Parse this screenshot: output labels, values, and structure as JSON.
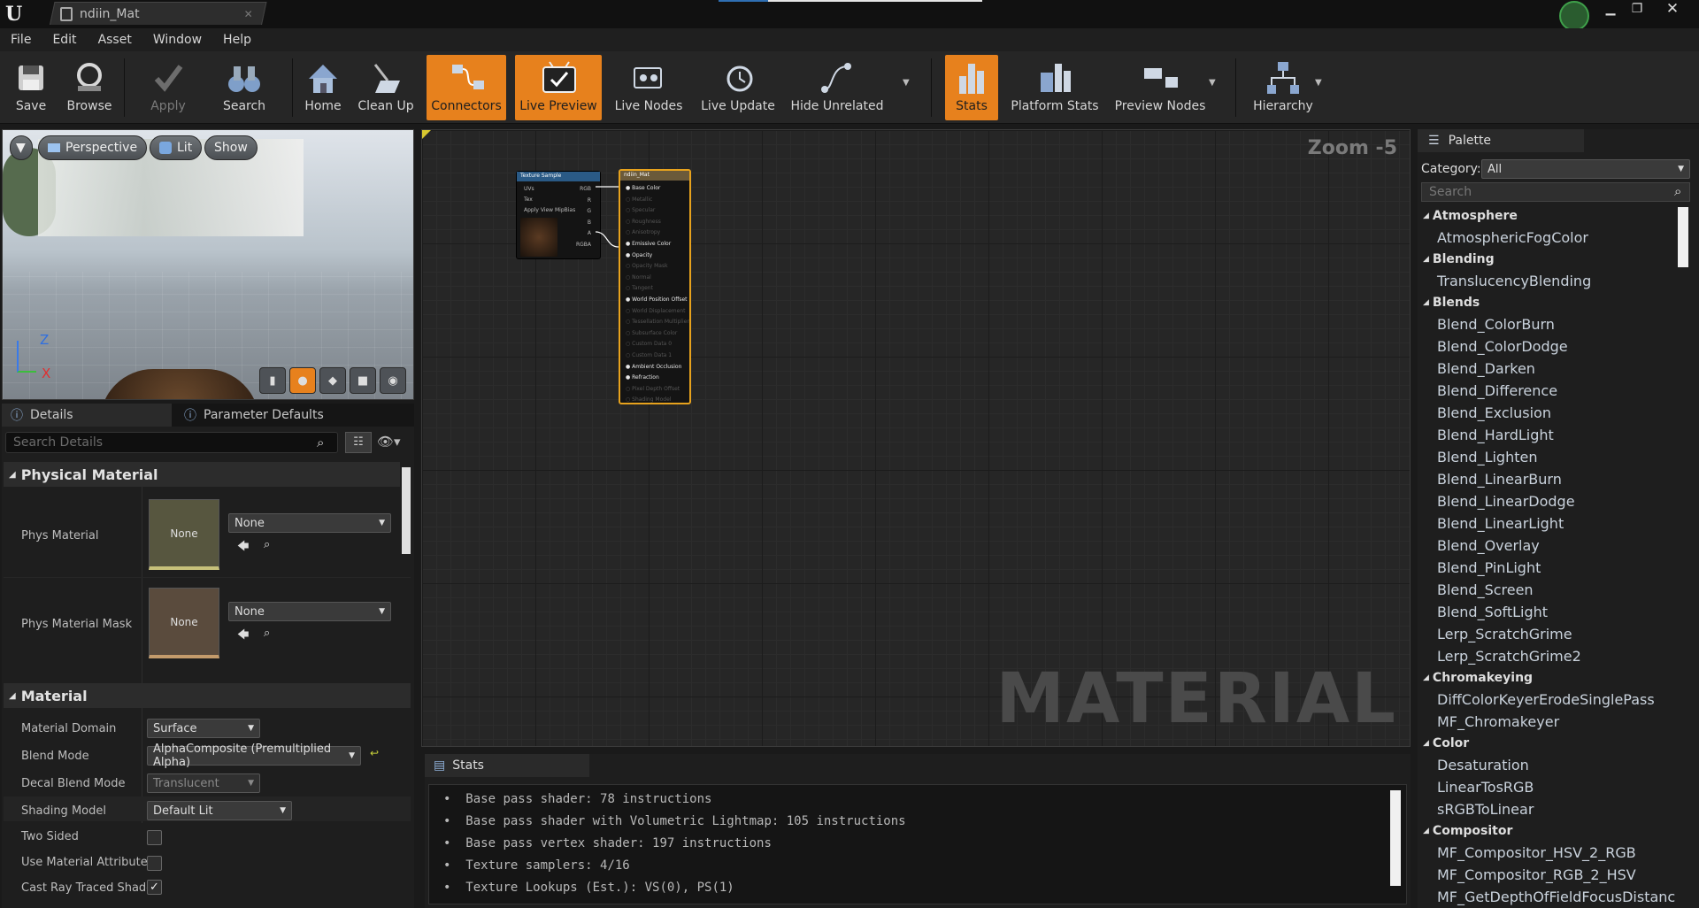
{
  "window": {
    "tab_title": "ndiin_Mat"
  },
  "menu": [
    "File",
    "Edit",
    "Asset",
    "Window",
    "Help"
  ],
  "toolbar": {
    "save": "Save",
    "browse": "Browse",
    "apply": "Apply",
    "search": "Search",
    "home": "Home",
    "clean_up": "Clean Up",
    "connectors": "Connectors",
    "live_preview": "Live Preview",
    "live_nodes": "Live Nodes",
    "live_update": "Live Update",
    "hide_unrelated": "Hide Unrelated",
    "stats": "Stats",
    "platform_stats": "Platform Stats",
    "preview_nodes": "Preview Nodes",
    "hierarchy": "Hierarchy",
    "accent": "#e7811d"
  },
  "viewport": {
    "perspective": "Perspective",
    "lit": "Lit",
    "show": "Show",
    "axis_z": "Z",
    "axis_x": "X"
  },
  "details": {
    "tab_details": "Details",
    "tab_params": "Parameter Defaults",
    "search_placeholder": "Search Details",
    "physical_material": {
      "header": "Physical Material",
      "phys_material_label": "Phys Material",
      "phys_material_thumb": "None",
      "phys_material_value": "None",
      "phys_material_mask_label": "Phys Material Mask",
      "phys_material_mask_thumb": "None",
      "phys_material_mask_value": "None"
    },
    "material": {
      "header": "Material",
      "domain_label": "Material Domain",
      "domain_value": "Surface",
      "blend_label": "Blend Mode",
      "blend_value": "AlphaComposite (Premultiplied Alpha)",
      "decal_label": "Decal Blend Mode",
      "decal_value": "Translucent",
      "shading_label": "Shading Model",
      "shading_value": "Default Lit",
      "two_sided_label": "Two Sided",
      "two_sided": false,
      "use_attr_label": "Use Material Attributes",
      "use_attr": false,
      "cast_rt_label": "Cast Ray Traced Shado",
      "cast_rt": true
    }
  },
  "graph": {
    "zoom": "Zoom -5",
    "watermark": "MATERIAL",
    "texture_node": {
      "title": "Texture Sample",
      "inputs": [
        "UVs",
        "Tex",
        "Apply View MipBias"
      ],
      "outputs": [
        "RGB",
        "R",
        "G",
        "B",
        "A",
        "RGBA"
      ]
    },
    "material_node": {
      "title": "ndiin_Mat",
      "pins": [
        "Base Color",
        "Metallic",
        "Specular",
        "Roughness",
        "Anisotropy",
        "Emissive Color",
        "Opacity",
        "Opacity Mask",
        "Normal",
        "Tangent",
        "World Position Offset",
        "World Displacement",
        "Tessellation Multiplier",
        "Subsurface Color",
        "Custom Data 0",
        "Custom Data 1",
        "Ambient Occlusion",
        "Refraction",
        "Pixel Depth Offset",
        "Shading Model"
      ]
    }
  },
  "stats": {
    "tab": "Stats",
    "lines": [
      "Base pass shader: 78 instructions",
      "Base pass shader with Volumetric Lightmap: 105 instructions",
      "Base pass vertex shader: 197 instructions",
      "Texture samplers: 4/16",
      "Texture Lookups (Est.): VS(0), PS(1)"
    ]
  },
  "palette": {
    "tab": "Palette",
    "category_label": "Category:",
    "category_value": "All",
    "search_placeholder": "Search",
    "groups": [
      {
        "name": "Atmosphere",
        "items": [
          "AtmosphericFogColor"
        ]
      },
      {
        "name": "Blending",
        "items": [
          "TranslucencyBlending"
        ]
      },
      {
        "name": "Blends",
        "items": [
          "Blend_ColorBurn",
          "Blend_ColorDodge",
          "Blend_Darken",
          "Blend_Difference",
          "Blend_Exclusion",
          "Blend_HardLight",
          "Blend_Lighten",
          "Blend_LinearBurn",
          "Blend_LinearDodge",
          "Blend_LinearLight",
          "Blend_Overlay",
          "Blend_PinLight",
          "Blend_Screen",
          "Blend_SoftLight",
          "Lerp_ScratchGrime",
          "Lerp_ScratchGrime2"
        ]
      },
      {
        "name": "Chromakeying",
        "items": [
          "DiffColorKeyerErodeSinglePass",
          "MF_Chromakeyer"
        ]
      },
      {
        "name": "Color",
        "items": [
          "Desaturation",
          "LinearTosRGB",
          "sRGBToLinear"
        ]
      },
      {
        "name": "Compositor",
        "items": [
          "MF_Compositor_HSV_2_RGB",
          "MF_Compositor_RGB_2_HSV",
          "MF_GetDepthOfFieldFocusDistanc"
        ]
      }
    ]
  }
}
